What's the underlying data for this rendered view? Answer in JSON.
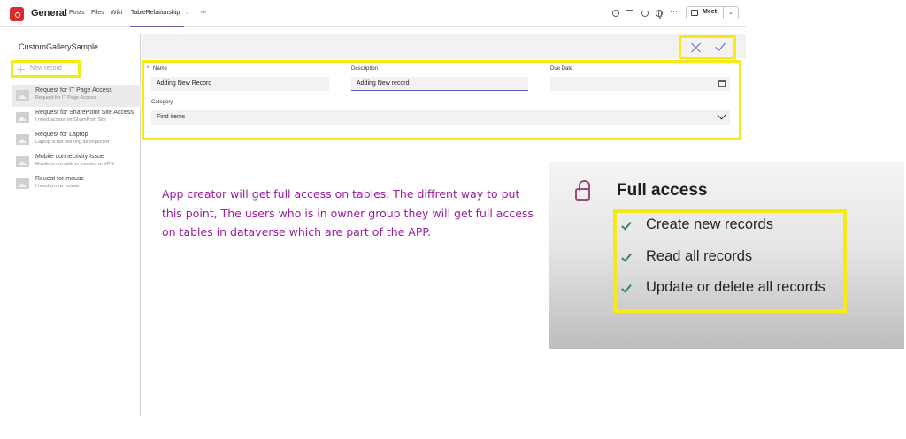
{
  "header": {
    "channel": "General",
    "tabs": [
      "Posts",
      "Files",
      "Wiki",
      "TableRelationship"
    ],
    "meet_label": "Meet"
  },
  "app": {
    "title": "CustomGallerySample",
    "new_record_label": "New record",
    "items": [
      {
        "title": "Request for IT Page Access",
        "subtitle": "Request for IT Page Access"
      },
      {
        "title": "Request for SharePoint Site Access",
        "subtitle": "I need access on SharePoin Site"
      },
      {
        "title": "Request for Laptop",
        "subtitle": "Laptop is not working as expected"
      },
      {
        "title": "Mobile connectivity Issue",
        "subtitle": "Mobile is not able to connect to VPN"
      },
      {
        "title": "Reuest for mouse",
        "subtitle": "I need a new mouse"
      }
    ],
    "form": {
      "name_label": "Name",
      "name_value": "Adding New Record",
      "description_label": "Description",
      "description_value": "Adding New record",
      "due_date_label": "Due Date",
      "due_date_value": "",
      "category_label": "Category",
      "category_placeholder": "Find items",
      "required_marker": "*"
    }
  },
  "annotation": "App creator will get full access on tables. The diffrent way to put this point, The users who is in owner group they will get full access on tables in dataverse which are part of the APP.",
  "permissions": {
    "title": "Full access",
    "items": [
      "Create new records",
      "Read all records",
      "Update or delete all records"
    ]
  },
  "colors": {
    "highlight": "#f5ea14",
    "accent": "#5b5fc7",
    "annotation_text": "#9b1ba0",
    "team_icon": "#d92c2c",
    "check": "#3a8b4f"
  }
}
